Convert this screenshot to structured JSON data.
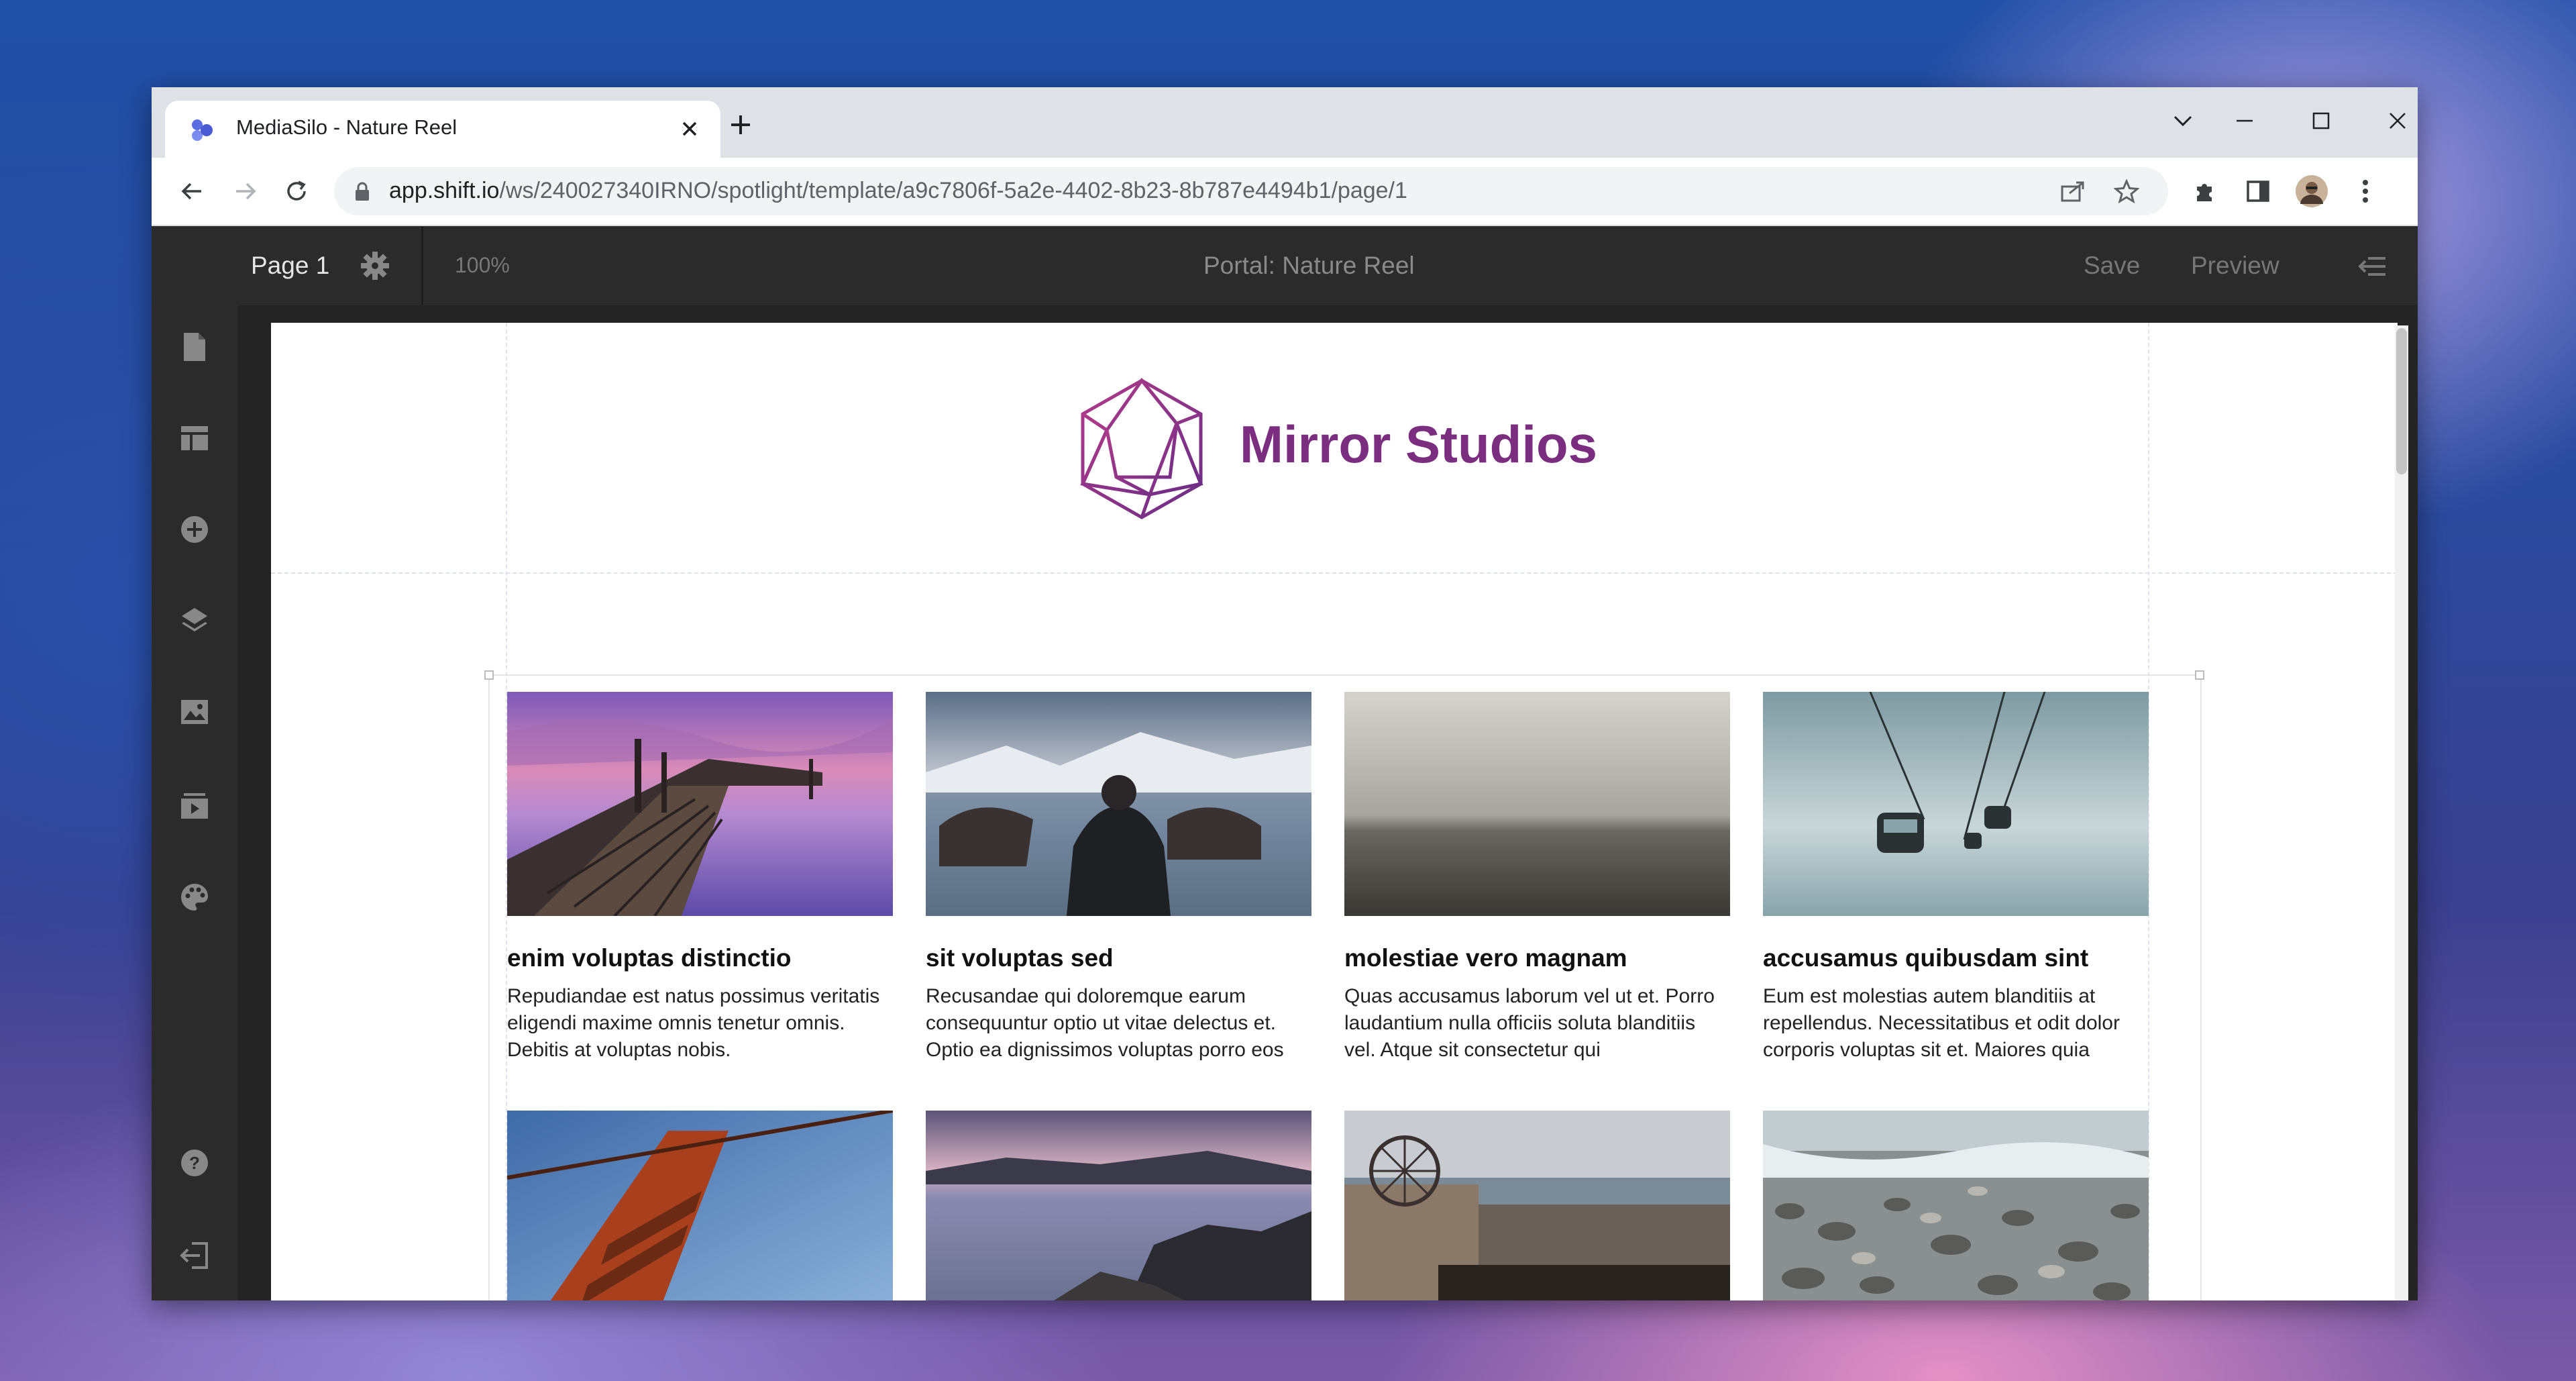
{
  "browser": {
    "tab_title": "MediaSilo - Nature Reel",
    "url_host": "app.shift.io",
    "url_path": "/ws/240027340IRNO/spotlight/template/a9c7806f-5a2e-4402-8b23-8b787e4494b1/page/1"
  },
  "editor": {
    "page_label": "Page 1",
    "zoom": "100%",
    "portal_title": "Portal: Nature Reel",
    "save_label": "Save",
    "preview_label": "Preview"
  },
  "sidebar": {
    "icons": [
      "page-icon",
      "layout-icon",
      "add-circle-icon",
      "layers-icon",
      "image-icon",
      "media-icon",
      "palette-icon",
      "help-icon",
      "exit-icon"
    ]
  },
  "brand": {
    "name": "Mirror Studios",
    "color": "#7b2d80"
  },
  "gallery": {
    "cards": [
      {
        "title": "enim voluptas distinctio",
        "desc": "Repudiandae est natus possimus veritatis eligendi maxime omnis tenetur omnis. Debitis at voluptas nobis."
      },
      {
        "title": "sit voluptas sed",
        "desc": "Recusandae qui doloremque earum consequuntur optio ut vitae delectus et. Optio ea dignissimos voluptas porro eos"
      },
      {
        "title": "molestiae vero magnam",
        "desc": "Quas accusamus laborum vel ut et. Porro laudantium nulla officiis soluta blanditiis vel. Atque sit consectetur qui"
      },
      {
        "title": "accusamus quibusdam sint",
        "desc": "Eum est molestias autem blanditiis at repellendus. Necessitatibus et odit dolor corporis voluptas sit et. Maiores quia"
      }
    ]
  }
}
